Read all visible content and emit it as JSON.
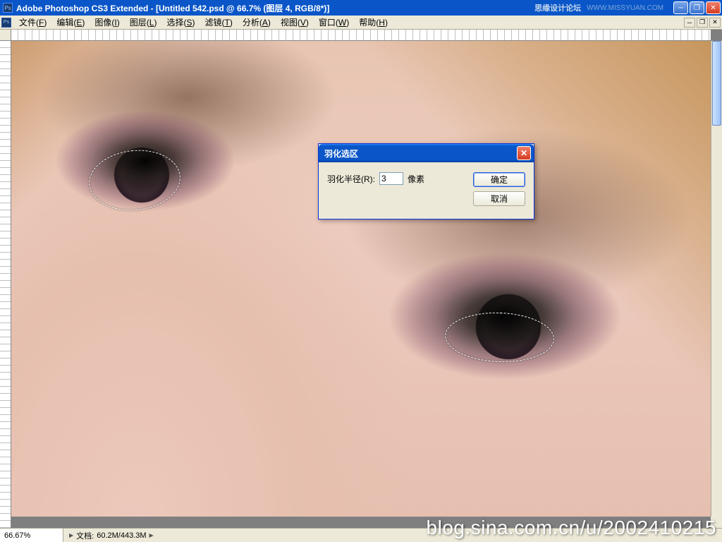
{
  "titlebar": {
    "app_text": "Adobe Photoshop CS3 Extended - [Untitled 542.psd @ 66.7% (图层 4, RGB/8*)]",
    "watermark1": "思缘设计论坛",
    "watermark2": "WWW.MISSYUAN.COM"
  },
  "menu": {
    "items": [
      {
        "label": "文件",
        "accel": "F"
      },
      {
        "label": "编辑",
        "accel": "E"
      },
      {
        "label": "图像",
        "accel": "I"
      },
      {
        "label": "图层",
        "accel": "L"
      },
      {
        "label": "选择",
        "accel": "S"
      },
      {
        "label": "滤镜",
        "accel": "T"
      },
      {
        "label": "分析",
        "accel": "A"
      },
      {
        "label": "视图",
        "accel": "V"
      },
      {
        "label": "窗口",
        "accel": "W"
      },
      {
        "label": "帮助",
        "accel": "H"
      }
    ]
  },
  "dialog": {
    "title": "羽化选区",
    "label": "羽化半径(R):",
    "value": "3",
    "unit": "像素",
    "ok": "确定",
    "cancel": "取消"
  },
  "status": {
    "zoom": "66.67%",
    "doc_label": "文档:",
    "doc_size": "60.2M/443.3M"
  },
  "blog_watermark": "blog.sina.com.cn/u/2002410215"
}
